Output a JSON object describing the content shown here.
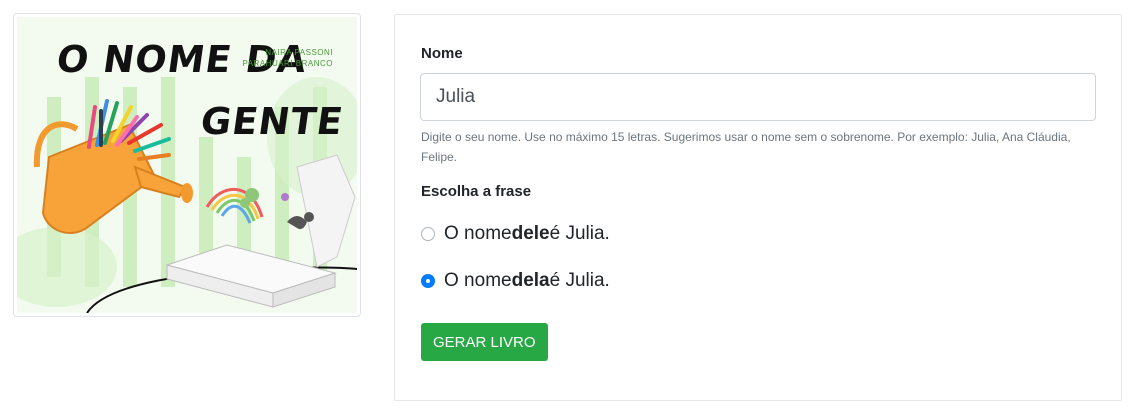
{
  "cover": {
    "title_line1": "O NOME DA",
    "title_line2": "GENTE",
    "author": "NAIRA PASSONI",
    "illustrator": "PARAHUARI BRANCO"
  },
  "form": {
    "name_label": "Nome",
    "name_value": "Julia",
    "name_help": "Digite o seu nome. Use no máximo 15 letras. Sugerimos usar o nome sem o sobrenome. Por exemplo: Julia, Ana Cláudia, Felipe.",
    "phrase_label": "Escolha a frase",
    "options": [
      {
        "prefix": "O nome ",
        "emph": "dele",
        "suffix": " é Julia.",
        "checked": false
      },
      {
        "prefix": "O nome ",
        "emph": "dela",
        "suffix": " é Julia.",
        "checked": true
      }
    ],
    "submit_label": "GERAR LIVRO"
  },
  "colors": {
    "accent_blue": "#007bff",
    "button_green": "#28a745",
    "cover_green": "#c9ecb8",
    "can_orange": "#f7a33a"
  }
}
